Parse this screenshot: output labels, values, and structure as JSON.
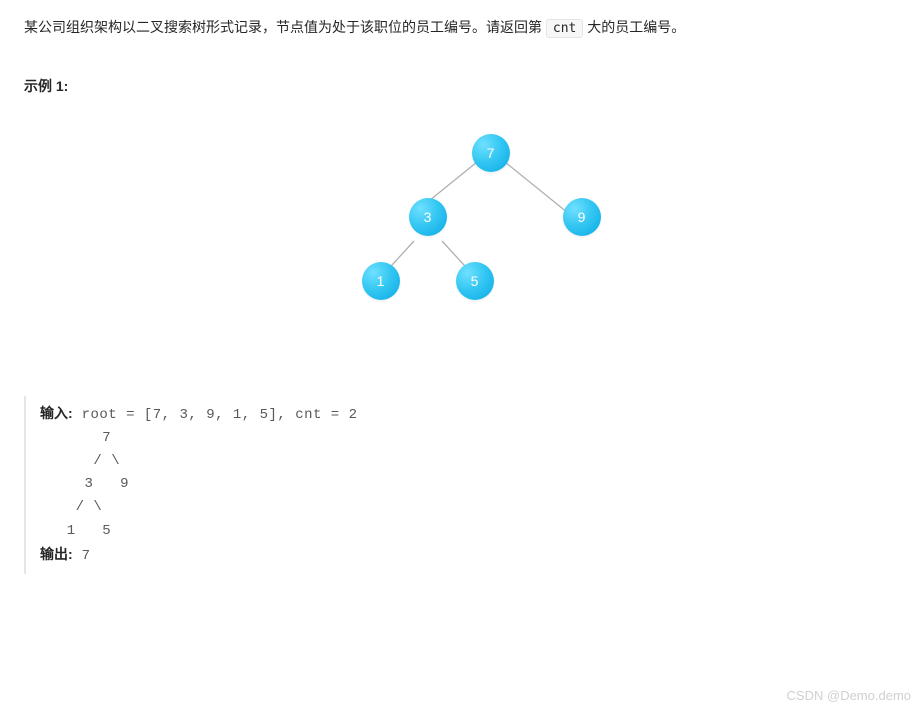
{
  "problem": {
    "desc_part1": "某公司组织架构以二叉搜索树形式记录，节点值为处于该职位的员工编号。请返回第 ",
    "desc_code": "cnt",
    "desc_part2": " 大的员工编号。"
  },
  "example": {
    "title": "示例 1:",
    "input_label": "输入:",
    "output_label": "输出:",
    "input_value": " root = [7, 3, 9, 1, 5], cnt = 2",
    "ascii_tree_l1": "       7",
    "ascii_tree_l2": "      / \\",
    "ascii_tree_l3": "     3   9",
    "ascii_tree_l4": "    / \\",
    "ascii_tree_l5": "   1   5",
    "output_value": " 7"
  },
  "tree": {
    "n7": "7",
    "n3": "3",
    "n9": "9",
    "n1": "1",
    "n5": "5"
  },
  "watermark": "CSDN @Demo.demo"
}
